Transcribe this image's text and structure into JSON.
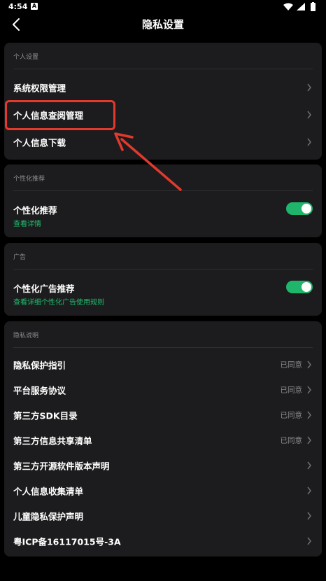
{
  "status_bar": {
    "time": "4:54",
    "a_badge": "A"
  },
  "header": {
    "title": "隐私设置",
    "back_icon": "chevron-left-icon"
  },
  "personal_settings": {
    "section_title": "个人设置",
    "items": [
      {
        "label": "系统权限管理"
      },
      {
        "label": "个人信息查阅管理"
      },
      {
        "label": "个人信息下载"
      }
    ]
  },
  "personalized": {
    "section_title": "个性化推荐",
    "toggle_label": "个性化推荐",
    "link_text": "查看详情",
    "enabled": true
  },
  "ads": {
    "section_title": "广告",
    "toggle_label": "个性化广告推荐",
    "link_text": "查看详细个性化广告使用规则",
    "enabled": true
  },
  "privacy_info": {
    "section_title": "隐私说明",
    "items": [
      {
        "label": "隐私保护指引",
        "status": "已同意"
      },
      {
        "label": "平台服务协议",
        "status": "已同意"
      },
      {
        "label": "第三方SDK目录",
        "status": "已同意"
      },
      {
        "label": "第三方信息共享清单",
        "status": "已同意"
      },
      {
        "label": "第三方开源软件版本声明",
        "status": ""
      },
      {
        "label": "个人信息收集清单",
        "status": ""
      },
      {
        "label": "儿童隐私保护声明",
        "status": ""
      },
      {
        "label": "粤ICP备16117015号-3A",
        "status": ""
      }
    ]
  },
  "colors": {
    "background": "#000000",
    "card": "#1c1c1e",
    "accent_green": "#1fb56b",
    "highlight_red": "#e3392c"
  }
}
